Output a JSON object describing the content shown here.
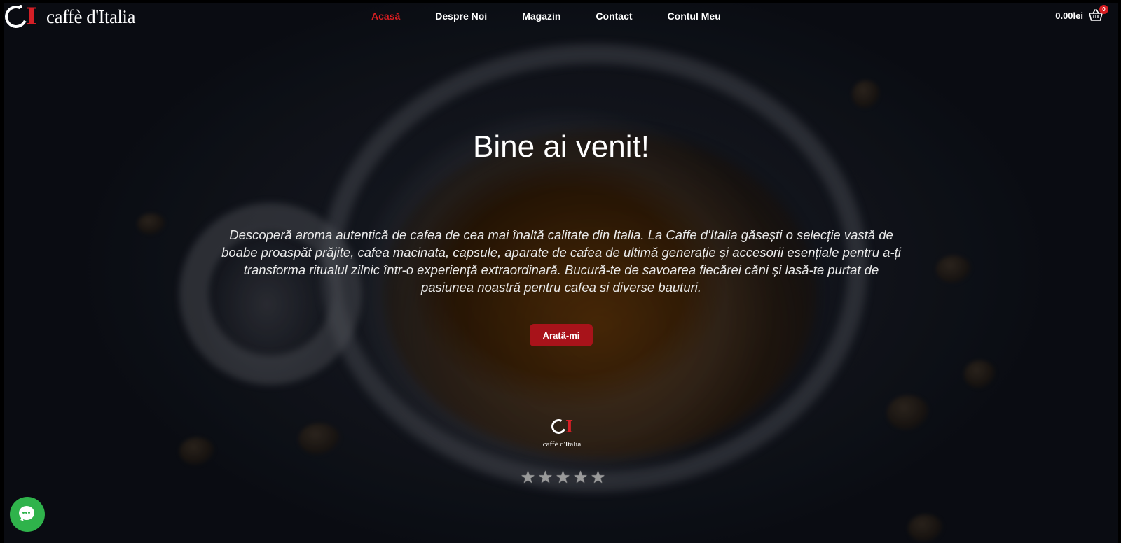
{
  "brand": {
    "name": "caffè d'Italia"
  },
  "nav": {
    "items": [
      {
        "label": "Acasă",
        "active": true
      },
      {
        "label": "Despre Noi",
        "active": false
      },
      {
        "label": "Magazin",
        "active": false
      },
      {
        "label": "Contact",
        "active": false
      },
      {
        "label": "Contul Meu",
        "active": false
      }
    ]
  },
  "cart": {
    "total": "0.00lei",
    "count": "0",
    "icon": "basket-icon"
  },
  "hero": {
    "title": "Bine ai venit!",
    "text": "Descoperă aroma autentică de cafea de cea mai înaltă calitate din Italia. La Caffe d'Italia găsești o selecție vastă de boabe proaspăt prăjite, cafea macinata, capsule, aparate de cafea de ultimă generație și accesorii esențiale pentru a-ți transforma ritualul zilnic într-o experiență extraordinară. Bucură-te de savoarea fiecărei căni și lasă-te purtat de pasiunea noastră pentru cafea si diverse bauturi.",
    "cta_label": "Arată-mi"
  },
  "badge": {
    "name": "caffè d'Italia"
  },
  "rating": {
    "stars": 5
  },
  "chat": {
    "icon": "chat-icon"
  },
  "colors": {
    "accent": "#d81e22",
    "button": "#a8131a",
    "chat": "#2fb34b"
  }
}
